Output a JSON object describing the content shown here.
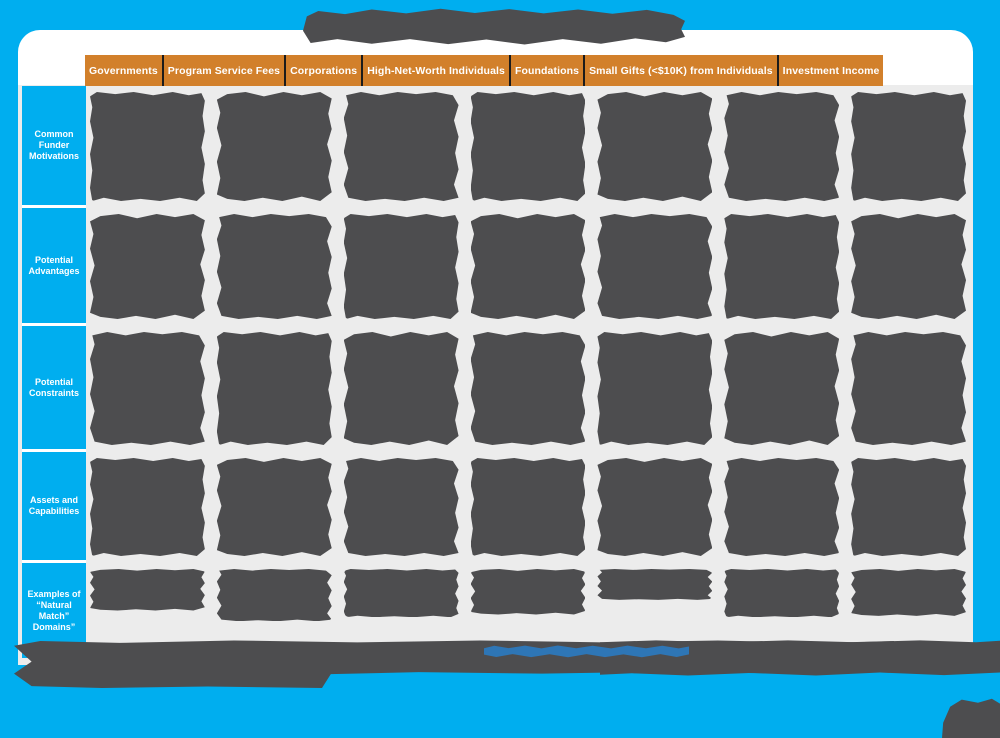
{
  "page": {
    "background_color": "#00AEEF",
    "card_background": "#ffffff",
    "matrix_background": "#ececec"
  },
  "title": {
    "text": "",
    "redacted": true,
    "redaction_color": "#4d4d4f"
  },
  "table": {
    "header_color": "#D2802B",
    "header_text_color": "#ffffff",
    "row_label_color": "#00AEEF",
    "row_label_text_color": "#ffffff",
    "cell_redaction_color": "#4d4d4f",
    "columns": [
      {
        "label": "Governments"
      },
      {
        "label": "Program Service Fees"
      },
      {
        "label": "Corporations"
      },
      {
        "label": "High-Net-Worth Individuals"
      },
      {
        "label": "Foundations"
      },
      {
        "label": "Small Gifts (<$10K) from Individuals"
      },
      {
        "label": "Investment Income"
      }
    ],
    "rows": [
      {
        "label": "Common Funder Motivations",
        "cells": [
          "",
          "",
          "",
          "",
          "",
          "",
          ""
        ]
      },
      {
        "label": "Potential Advantages",
        "cells": [
          "",
          "",
          "",
          "",
          "",
          "",
          ""
        ]
      },
      {
        "label": "Potential Constraints",
        "cells": [
          "",
          "",
          "",
          "",
          "",
          "",
          ""
        ]
      },
      {
        "label": "Assets and Capabilities",
        "cells": [
          "",
          "",
          "",
          "",
          "",
          "",
          ""
        ]
      },
      {
        "label": "Examples of “Natural Match” Domains”",
        "cells": [
          "",
          "",
          "",
          "",
          "",
          "",
          ""
        ]
      }
    ]
  },
  "footer": {
    "text_redacted": true,
    "link_redacted": true,
    "redaction_color": "#4d4d4f",
    "link_redaction_color": "#2E76B6"
  }
}
